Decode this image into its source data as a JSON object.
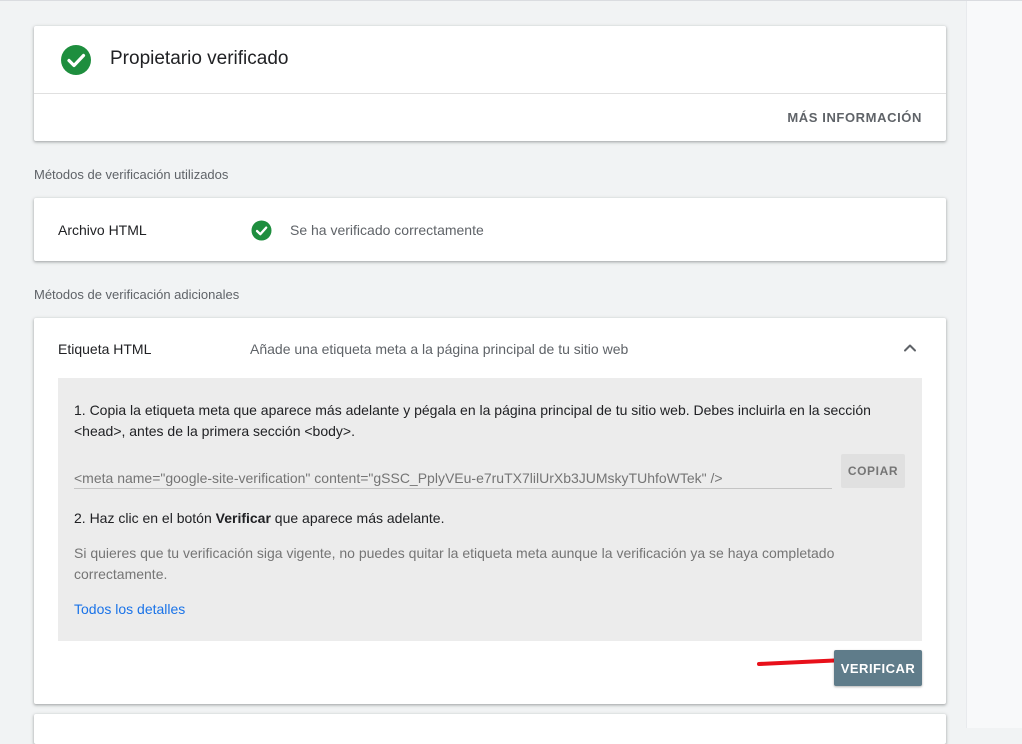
{
  "owner": {
    "title": "Propietario verificado",
    "more_info": "MÁS INFORMACIÓN",
    "icon": "check-circle-icon"
  },
  "used_methods": {
    "section_label": "Métodos de verificación utilizados",
    "items": [
      {
        "name": "Archivo HTML",
        "status": "Se ha verificado correctamente",
        "icon": "check-circle-icon"
      }
    ]
  },
  "additional_methods": {
    "section_label": "Métodos de verificación adicionales",
    "html_tag": {
      "title": "Etiqueta HTML",
      "description": "Añade una etiqueta meta a la página principal de tu sitio web",
      "step1": "1. Copia la etiqueta meta que aparece más adelante y pégala en la página principal de tu sitio web. Debes incluirla en la sección <head>, antes de la primera sección <body>.",
      "meta_tag_value": "<meta name=\"google-site-verification\" content=\"gSSC_PplyVEu-e7ruTX7lilUrXb3JUMskyTUhfoWTek\" />",
      "copy_label": "COPIAR",
      "step2_prefix": "2. Haz clic en el botón ",
      "step2_bold": "Verificar",
      "step2_suffix": " que aparece más adelante.",
      "note": "Si quieres que tu verificación siga vigente, no puedes quitar la etiqueta meta aunque la verificación ya se haya completado correctamente.",
      "details_link": "Todos los detalles",
      "verify_label": "VERIFICAR"
    }
  },
  "colors": {
    "success_green": "#1e8e3e",
    "link_blue": "#1a73e8",
    "verify_button": "#5f7c8a",
    "annotation_arrow": "#e8101a"
  }
}
